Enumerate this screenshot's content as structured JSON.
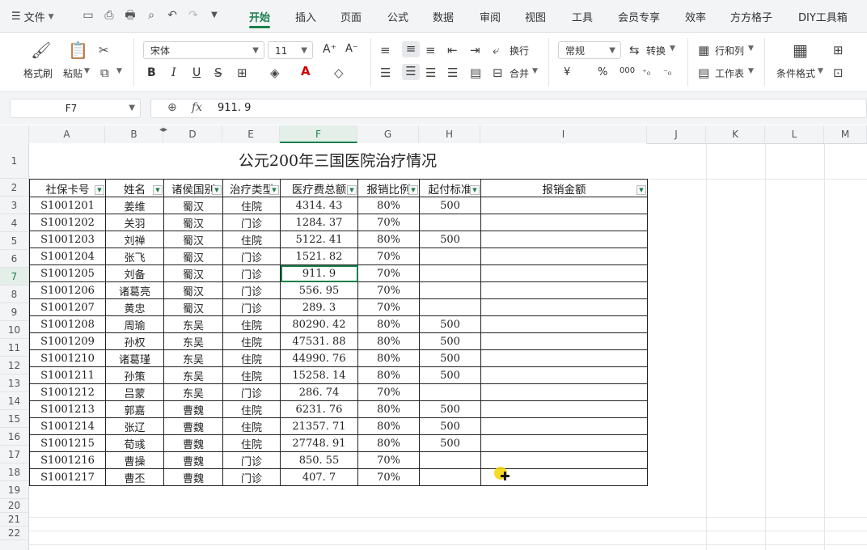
{
  "topbar": {
    "file_label": "文件",
    "tabs": [
      "开始",
      "插入",
      "页面",
      "公式",
      "数据",
      "审阅",
      "视图",
      "工具",
      "会员专享",
      "效率",
      "方方格子",
      "DIY工具箱"
    ],
    "active_tab": "开始"
  },
  "ribbon": {
    "format_painter": "格式刷",
    "paste": "粘贴",
    "font_name": "宋体",
    "font_size": "11",
    "wrap": "换行",
    "merge": "合并",
    "number_format": "常规",
    "convert": "转换",
    "rows_cols": "行和列",
    "worksheet": "工作表",
    "cond_format": "条件格式",
    "bold": "B",
    "italic": "I",
    "underline": "U",
    "increase_font": "A⁺",
    "decrease_font": "A⁻",
    "currency": "¥",
    "percent": "%",
    "thousands": "000"
  },
  "formula_bar": {
    "cell_ref": "F7",
    "fx": "fx",
    "value": "911. 9"
  },
  "columns": [
    "A",
    "B",
    "D",
    "E",
    "F",
    "G",
    "H",
    "I",
    "J",
    "K",
    "L",
    "M"
  ],
  "rows": [
    "1",
    "2",
    "3",
    "4",
    "5",
    "6",
    "7",
    "8",
    "9",
    "10",
    "11",
    "12",
    "13",
    "14",
    "15",
    "16",
    "17",
    "18",
    "19",
    "20",
    "21",
    "22"
  ],
  "sheet": {
    "title": "公元200年三国医院治疗情况",
    "headers": [
      "社保卡号",
      "姓名",
      "诸侯国别",
      "治疗类型",
      "医疗费总额",
      "报销比例",
      "起付标准",
      "报销金额"
    ],
    "records": [
      [
        "S1001201",
        "姜维",
        "蜀汉",
        "住院",
        "4314. 43",
        "80%",
        "500",
        ""
      ],
      [
        "S1001202",
        "关羽",
        "蜀汉",
        "门诊",
        "1284. 37",
        "70%",
        "",
        ""
      ],
      [
        "S1001203",
        "刘禅",
        "蜀汉",
        "住院",
        "5122. 41",
        "80%",
        "500",
        ""
      ],
      [
        "S1001204",
        "张飞",
        "蜀汉",
        "门诊",
        "1521. 82",
        "70%",
        "",
        ""
      ],
      [
        "S1001205",
        "刘备",
        "蜀汉",
        "门诊",
        "911. 9",
        "70%",
        "",
        ""
      ],
      [
        "S1001206",
        "诸葛亮",
        "蜀汉",
        "门诊",
        "556. 95",
        "70%",
        "",
        ""
      ],
      [
        "S1001207",
        "黄忠",
        "蜀汉",
        "门诊",
        "289. 3",
        "70%",
        "",
        ""
      ],
      [
        "S1001208",
        "周瑜",
        "东吴",
        "住院",
        "80290. 42",
        "80%",
        "500",
        ""
      ],
      [
        "S1001209",
        "孙权",
        "东吴",
        "住院",
        "47531. 88",
        "80%",
        "500",
        ""
      ],
      [
        "S1001210",
        "诸葛瑾",
        "东吴",
        "住院",
        "44990. 76",
        "80%",
        "500",
        ""
      ],
      [
        "S1001211",
        "孙策",
        "东吴",
        "住院",
        "15258. 14",
        "80%",
        "500",
        ""
      ],
      [
        "S1001212",
        "吕蒙",
        "东吴",
        "门诊",
        "286. 74",
        "70%",
        "",
        ""
      ],
      [
        "S1001213",
        "郭嘉",
        "曹魏",
        "住院",
        "6231. 76",
        "80%",
        "500",
        ""
      ],
      [
        "S1001214",
        "张辽",
        "曹魏",
        "住院",
        "21357. 71",
        "80%",
        "500",
        ""
      ],
      [
        "S1001215",
        "荀彧",
        "曹魏",
        "住院",
        "27748. 91",
        "80%",
        "500",
        ""
      ],
      [
        "S1001216",
        "曹操",
        "曹魏",
        "门诊",
        "850. 55",
        "70%",
        "",
        ""
      ],
      [
        "S1001217",
        "曹丕",
        "曹魏",
        "门诊",
        "407. 7",
        "70%",
        "",
        ""
      ]
    ]
  },
  "colors": {
    "accent": "#1a7f4b",
    "selection_bg": "#e3efe8"
  },
  "icons": [
    "chevron-down-icon",
    "save-icon",
    "print-icon",
    "undo-icon",
    "redo-icon",
    "search-zoom-icon",
    "filter-dropdown-icon",
    "cursor-icon"
  ]
}
